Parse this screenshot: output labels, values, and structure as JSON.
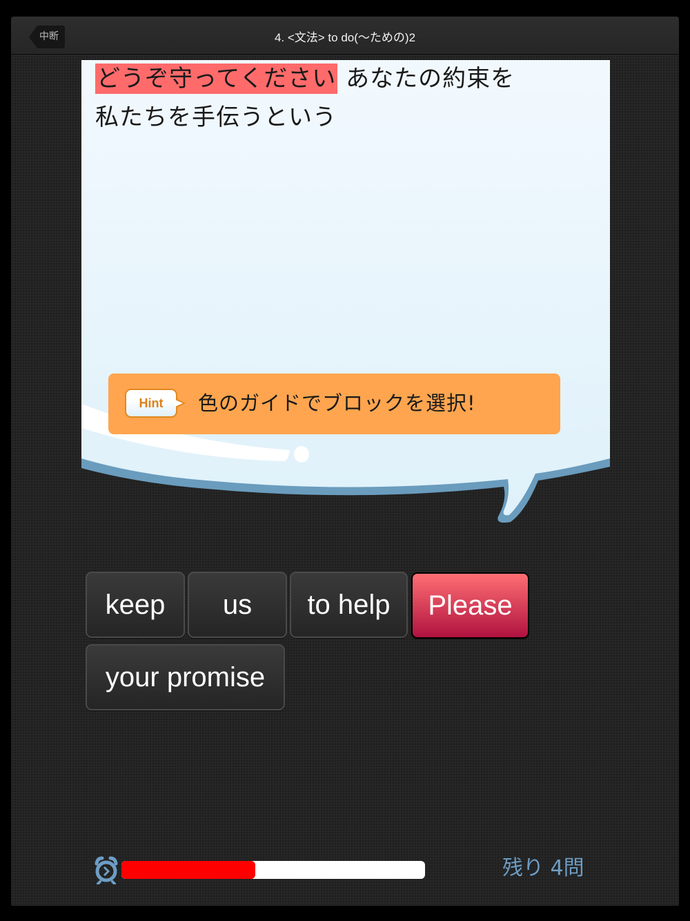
{
  "navbar": {
    "back_label": "中断",
    "title": "4. <文法> to do(〜ための)2"
  },
  "question": {
    "highlighted": "どうぞ守ってください",
    "line1_rest": " あなたの約束を",
    "line2": "私たちを手伝うという"
  },
  "hint": {
    "badge": "Hint",
    "text": "色のガイドでブロックを選択!"
  },
  "tiles": [
    {
      "label": "keep",
      "active": false
    },
    {
      "label": "us",
      "active": false
    },
    {
      "label": "to help",
      "active": false
    },
    {
      "label": "Please",
      "active": true
    },
    {
      "label": "your promise",
      "active": false
    }
  ],
  "footer": {
    "timer_icon": "alarm-clock-icon",
    "time_progress_percent": 44,
    "remaining_label": "残り 4問"
  },
  "colors": {
    "highlight": "#ff6b6b",
    "hint_bg": "#ffa54f",
    "active_tile": "#d23a55",
    "progress_fill": "#ff0000",
    "remaining_text": "#6d9dc5",
    "bubble_fill": "#eaf6fc",
    "bubble_border": "#6a9cbd"
  }
}
